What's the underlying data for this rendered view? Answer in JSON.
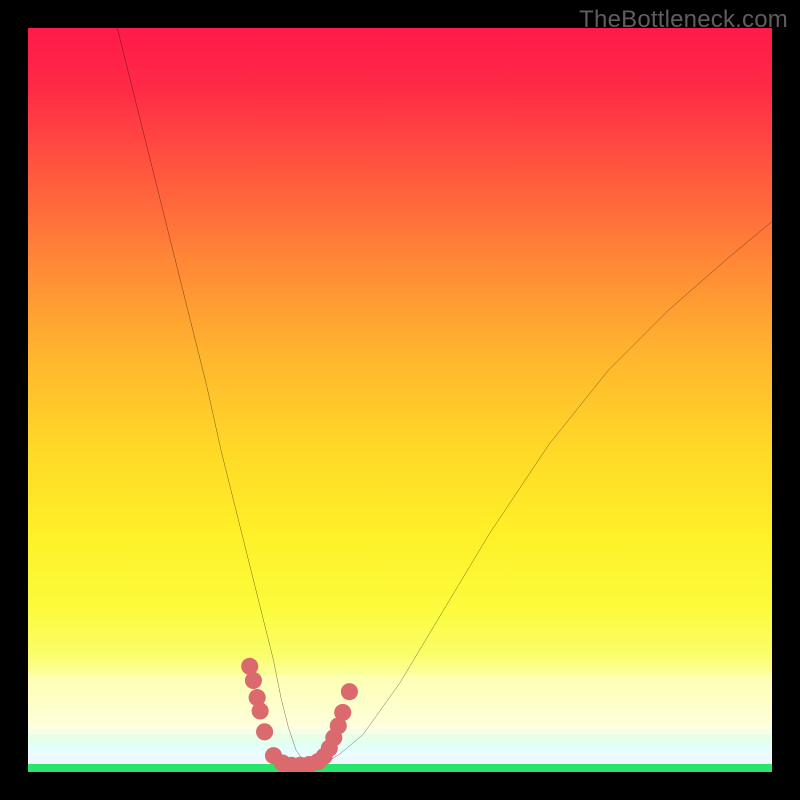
{
  "watermark": "TheBottleneck.com",
  "chart_data": {
    "type": "line",
    "title": "",
    "xlabel": "",
    "ylabel": "",
    "xlim": [
      0,
      100
    ],
    "ylim": [
      0,
      100
    ],
    "series": [
      {
        "name": "bottleneck-curve",
        "x": [
          12,
          15,
          18,
          21,
          24,
          26,
          28,
          30,
          31.5,
          33,
          34,
          35,
          36,
          37,
          38.5,
          40,
          42,
          45,
          50,
          56,
          62,
          70,
          78,
          86,
          94,
          100
        ],
        "y": [
          100,
          88,
          76,
          64,
          52,
          43,
          35,
          27,
          21,
          15,
          10,
          6,
          3,
          1.5,
          1,
          1.2,
          2.5,
          5,
          12,
          22,
          32,
          44,
          54,
          62,
          69,
          74
        ]
      }
    ],
    "markers": {
      "name": "highlight-dots",
      "color": "#da6a6e",
      "points": [
        {
          "x": 29.8,
          "y": 14.2
        },
        {
          "x": 30.3,
          "y": 12.3
        },
        {
          "x": 30.8,
          "y": 10.0
        },
        {
          "x": 31.2,
          "y": 8.2
        },
        {
          "x": 31.8,
          "y": 5.4
        },
        {
          "x": 33.0,
          "y": 2.2
        },
        {
          "x": 34.2,
          "y": 1.2
        },
        {
          "x": 35.4,
          "y": 0.9
        },
        {
          "x": 36.6,
          "y": 0.9
        },
        {
          "x": 37.8,
          "y": 1.0
        },
        {
          "x": 39.0,
          "y": 1.4
        },
        {
          "x": 39.8,
          "y": 2.1
        },
        {
          "x": 40.5,
          "y": 3.2
        },
        {
          "x": 41.1,
          "y": 4.6
        },
        {
          "x": 41.7,
          "y": 6.2
        },
        {
          "x": 42.3,
          "y": 8.0
        },
        {
          "x": 43.2,
          "y": 10.8
        }
      ]
    },
    "background_gradient": {
      "top": "#ff1a4a",
      "mid": "#fff028",
      "bottom": "#28e66b"
    },
    "pastel_stripes": [
      "#f6ffe6",
      "#e8ffe6",
      "#e2fff0",
      "#e4fffa",
      "#eafcff",
      "#f2f6ff"
    ]
  }
}
